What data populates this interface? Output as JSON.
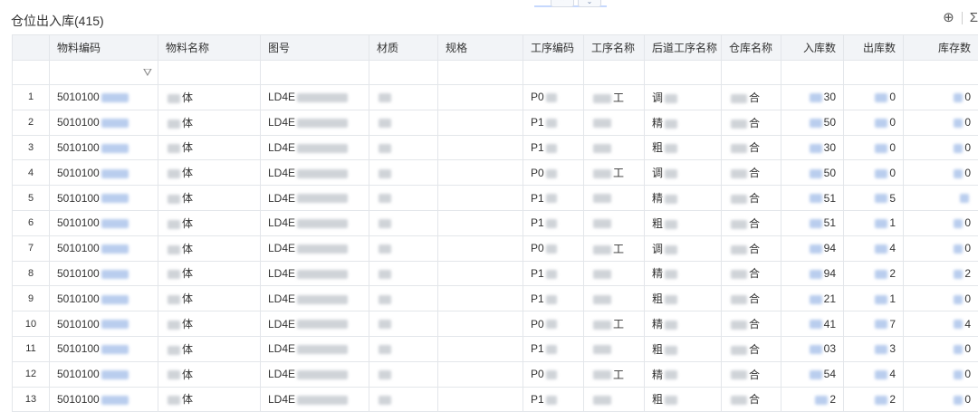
{
  "page": {
    "title": "仓位出入库(415)",
    "tabs": [
      "⌃",
      "⌄"
    ],
    "tools": [
      "⊕",
      "Σ"
    ]
  },
  "table": {
    "columns": [
      "",
      "物料编码",
      "物料名称",
      "图号",
      "材质",
      "规格",
      "工序编码",
      "工序名称",
      "后道工序名称",
      "仓库名称",
      "入库数",
      "出库数",
      "库存数"
    ],
    "rows": [
      {
        "idx": "1",
        "code": "5010100",
        "name": "体",
        "drawing": "LD4E",
        "proc_code": "P0",
        "proc_name": "工",
        "next": "调",
        "wh": "合",
        "in": "30",
        "out": "0",
        "stock": "0"
      },
      {
        "idx": "2",
        "code": "5010100",
        "name": "体",
        "drawing": "LD4E",
        "proc_code": "P1",
        "proc_name": "",
        "next": "精",
        "wh": "合",
        "in": "50",
        "out": "0",
        "stock": "0"
      },
      {
        "idx": "3",
        "code": "5010100",
        "name": "体",
        "drawing": "LD4E",
        "proc_code": "P1",
        "proc_name": "",
        "next": "粗",
        "wh": "合",
        "in": "30",
        "out": "0",
        "stock": "0"
      },
      {
        "idx": "4",
        "code": "5010100",
        "name": "体",
        "drawing": "LD4E",
        "proc_code": "P0",
        "proc_name": "工",
        "next": "调",
        "wh": "合",
        "in": "50",
        "out": "0",
        "stock": "0"
      },
      {
        "idx": "5",
        "code": "5010100",
        "name": "体",
        "drawing": "LD4E",
        "proc_code": "P1",
        "proc_name": "",
        "next": "精",
        "wh": "合",
        "in": "51",
        "out": "5",
        "stock": ""
      },
      {
        "idx": "6",
        "code": "5010100",
        "name": "体",
        "drawing": "LD4E",
        "proc_code": "P1",
        "proc_name": "",
        "next": "粗",
        "wh": "合",
        "in": "51",
        "out": "1",
        "stock": "0"
      },
      {
        "idx": "7",
        "code": "5010100",
        "name": "体",
        "drawing": "LD4E",
        "proc_code": "P0",
        "proc_name": "工",
        "next": "调",
        "wh": "合",
        "in": "94",
        "out": "4",
        "stock": "0"
      },
      {
        "idx": "8",
        "code": "5010100",
        "name": "体",
        "drawing": "LD4E",
        "proc_code": "P1",
        "proc_name": "",
        "next": "精",
        "wh": "合",
        "in": "94",
        "out": "2",
        "stock": "2"
      },
      {
        "idx": "9",
        "code": "5010100",
        "name": "体",
        "drawing": "LD4E",
        "proc_code": "P1",
        "proc_name": "",
        "next": "粗",
        "wh": "合",
        "in": "21",
        "out": "1",
        "stock": "0"
      },
      {
        "idx": "10",
        "code": "5010100",
        "name": "体",
        "drawing": "LD4E",
        "proc_code": "P0",
        "proc_name": "工",
        "next": "精",
        "wh": "合",
        "in": "41",
        "out": "7",
        "stock": "4"
      },
      {
        "idx": "11",
        "code": "5010100",
        "name": "体",
        "drawing": "LD4E",
        "proc_code": "P1",
        "proc_name": "",
        "next": "粗",
        "wh": "合",
        "in": "03",
        "out": "3",
        "stock": "0"
      },
      {
        "idx": "12",
        "code": "5010100",
        "name": "体",
        "drawing": "LD4E",
        "proc_code": "P0",
        "proc_name": "工",
        "next": "精",
        "wh": "合",
        "in": "54",
        "out": "4",
        "stock": "0"
      },
      {
        "idx": "13",
        "code": "5010100",
        "name": "体",
        "drawing": "LD4E",
        "proc_code": "P1",
        "proc_name": "",
        "next": "粗",
        "wh": "合",
        "in": "2",
        "out": "2",
        "stock": "0"
      }
    ]
  }
}
